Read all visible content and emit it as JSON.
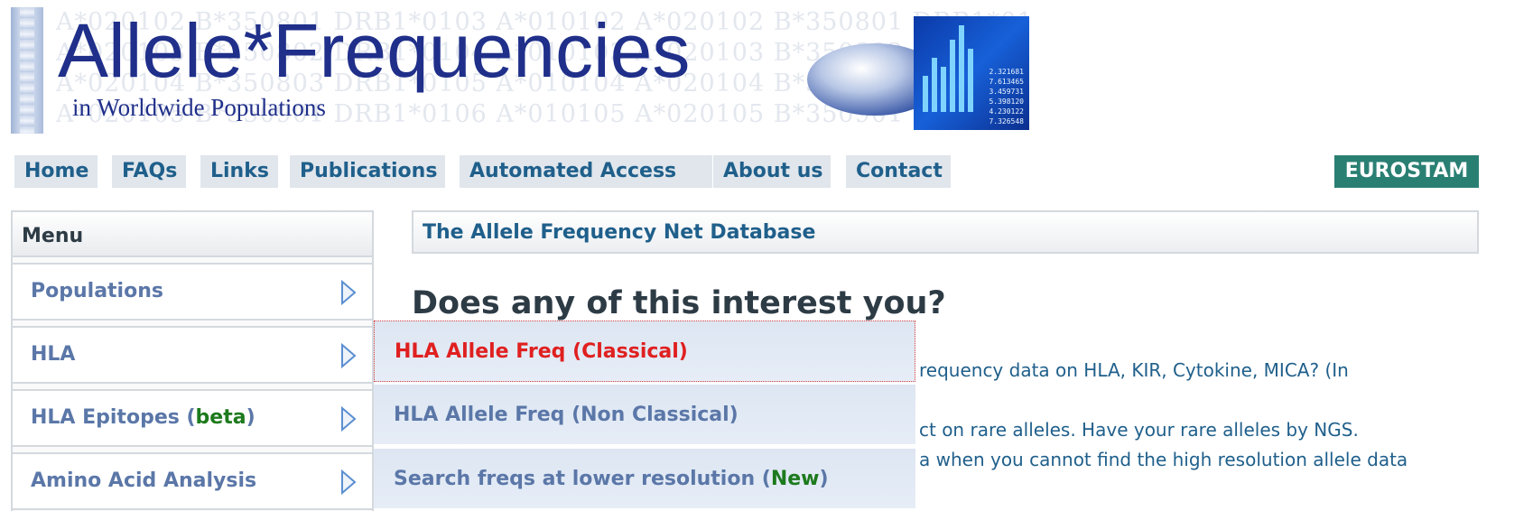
{
  "banner": {
    "title": "Allele*Frequencies",
    "subtitle": "in Worldwide Populations",
    "background_lines": [
      "A*020102   B*350801   DRB1*0103   A*010102   A*020102 B*350801 DRB1*0103",
      "A*020103   B*350802   DRB1*0104   A*010103   A*020103 B*350802",
      "A*020104   B*350803   DRB1*0105   A*010104   A*020104 B*350803",
      "A*020105   B*350901   DRB1*0106   A*010105   A*020105 B*350901"
    ],
    "chart_numbers": [
      "2.321681",
      "7.613465",
      "3.459731",
      "5.398120",
      "4.230122",
      "7.326548"
    ]
  },
  "nav": {
    "home": "Home",
    "faqs": "FAQs",
    "links": "Links",
    "publications": "Publications",
    "automated_access": "Automated Access",
    "about_us": "About us",
    "contact": "Contact",
    "eurostam": "EUROSTAM"
  },
  "menu": {
    "title": "Menu",
    "populations": "Populations",
    "hla": "HLA",
    "hla_epitopes_prefix": "HLA Epitopes (",
    "hla_epitopes_beta": "beta",
    "hla_epitopes_suffix": ")",
    "amino_acid": "Amino Acid Analysis"
  },
  "main": {
    "box_title": "The Allele Frequency Net Database",
    "heading": "Does any of this interest you?",
    "line1": "requency data on HLA, KIR, Cytokine, MICA? (In",
    "line2": "ct on rare alleles. Have your rare alleles by NGS.",
    "line3": "a when you cannot find the high resolution allele data"
  },
  "submenu": {
    "item1": "HLA Allele Freq (Classical)",
    "item2": "HLA Allele Freq (Non Classical)",
    "item3_prefix": "Search freqs at lower resolution (",
    "item3_new": "New",
    "item3_suffix": ")"
  },
  "colors": {
    "nav_bg": "#e0e6ec",
    "nav_text": "#1f5f8b",
    "eurostam_bg": "#2a7f73",
    "menu_label": "#5b77a8",
    "active_red": "#e02020",
    "beta_green": "#1d7a1d",
    "banner_blue": "#1f2f8a"
  },
  "icons": {
    "menu_arrow": "triangle-right-icon"
  }
}
